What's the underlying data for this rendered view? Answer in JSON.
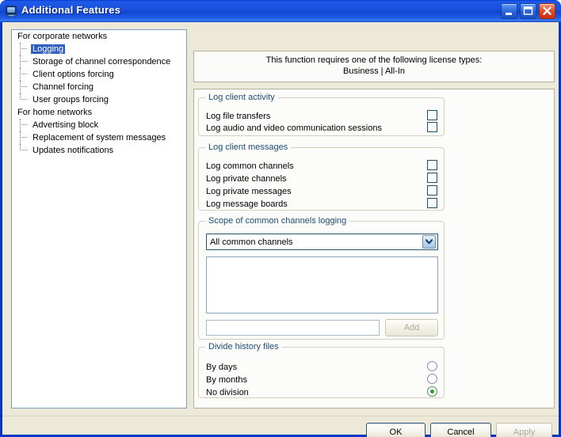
{
  "window": {
    "title": "Additional Features",
    "icon": "computer-monitor-icon",
    "controls": {
      "minimize": "minimize-icon",
      "maximize": "maximize-icon",
      "close": "close-icon"
    },
    "colors": {
      "titlebar_blue": "#1A50DC",
      "dialog_background": "#ECE9D8",
      "panel_background": "#FCFCFA",
      "group_title": "#1C4D73",
      "selection_blue": "#2F5FBE",
      "radio_green": "#2E9B2E",
      "disabled_text": "#ACA899"
    }
  },
  "tree": {
    "nodes": [
      {
        "label": "For corporate networks",
        "type": "root",
        "selected": false
      },
      {
        "label": "Logging",
        "type": "child",
        "selected": true
      },
      {
        "label": "Storage of channel correspondence",
        "type": "child",
        "selected": false
      },
      {
        "label": "Client options forcing",
        "type": "child",
        "selected": false
      },
      {
        "label": "Channel forcing",
        "type": "child",
        "selected": false
      },
      {
        "label": "User groups forcing",
        "type": "child",
        "selected": false,
        "last": true
      },
      {
        "label": "For home networks",
        "type": "root",
        "selected": false
      },
      {
        "label": "Advertising block",
        "type": "child",
        "selected": false
      },
      {
        "label": "Replacement of system messages",
        "type": "child",
        "selected": false
      },
      {
        "label": "Updates notifications",
        "type": "child",
        "selected": false,
        "last": true
      }
    ]
  },
  "license_notice": {
    "line1": "This function requires one of the following license types:",
    "line2": "Business | All-In"
  },
  "groups": {
    "log_client_activity": {
      "title": "Log client activity",
      "items": [
        {
          "label": "Log file transfers",
          "checked": false
        },
        {
          "label": "Log audio and video communication sessions",
          "checked": false
        }
      ]
    },
    "log_client_messages": {
      "title": "Log client messages",
      "items": [
        {
          "label": "Log common channels",
          "checked": false
        },
        {
          "label": "Log private channels",
          "checked": false
        },
        {
          "label": "Log private messages",
          "checked": false
        },
        {
          "label": "Log message boards",
          "checked": false
        }
      ]
    },
    "scope_of_common_channels_logging": {
      "title": "Scope of common channels logging",
      "combo": {
        "selected": "All common channels",
        "options": [
          "All common channels"
        ],
        "arrow_icon": "chevron-down-icon"
      },
      "list_items": [],
      "channel_input": {
        "value": "",
        "placeholder": ""
      },
      "add_button": {
        "label": "Add",
        "enabled": false
      }
    },
    "divide_history_files": {
      "title": "Divide history files",
      "options": [
        {
          "label": "By days",
          "selected": false
        },
        {
          "label": "By months",
          "selected": false
        },
        {
          "label": "No division",
          "selected": true
        }
      ]
    }
  },
  "footer": {
    "ok": {
      "label": "OK",
      "enabled": true
    },
    "cancel": {
      "label": "Cancel",
      "enabled": true
    },
    "apply": {
      "label": "Apply",
      "enabled": false
    }
  }
}
